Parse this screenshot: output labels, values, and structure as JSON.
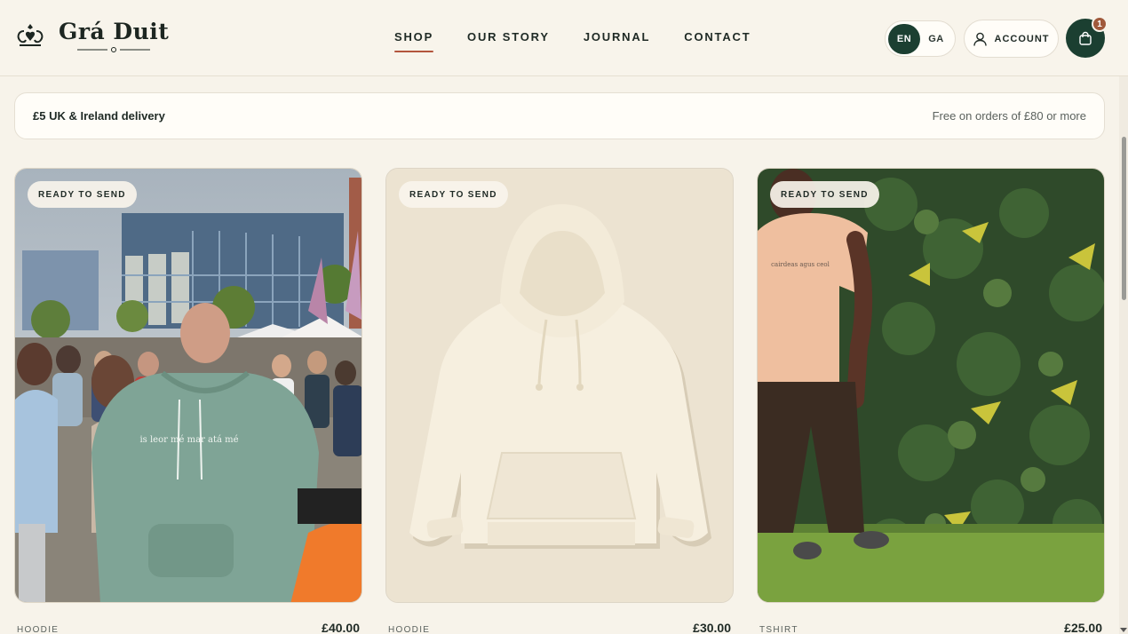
{
  "brand": {
    "name": "Grá Duit"
  },
  "nav": [
    {
      "label": "SHOP",
      "active": true
    },
    {
      "label": "OUR STORY",
      "active": false
    },
    {
      "label": "JOURNAL",
      "active": false
    },
    {
      "label": "CONTACT",
      "active": false
    }
  ],
  "language": {
    "options": [
      "EN",
      "GA"
    ],
    "selected": "EN"
  },
  "account": {
    "label": "ACCOUNT"
  },
  "cart": {
    "count": "1"
  },
  "delivery": {
    "left": "£5 UK & Ireland delivery",
    "right": "Free on orders of £80 or more"
  },
  "products": [
    {
      "badge": "READY TO SEND",
      "category": "HOODIE",
      "price": "£40.00",
      "print": "is leor mé mar atá mé"
    },
    {
      "badge": "READY TO SEND",
      "category": "HOODIE",
      "price": "£30.00"
    },
    {
      "badge": "READY TO SEND",
      "category": "TSHIRT",
      "price": "£25.00",
      "print": "cairdeas agus ceol"
    }
  ],
  "colors": {
    "brand_green": "#1b3f31",
    "accent": "#b3553d",
    "background": "#f7f3ea"
  }
}
